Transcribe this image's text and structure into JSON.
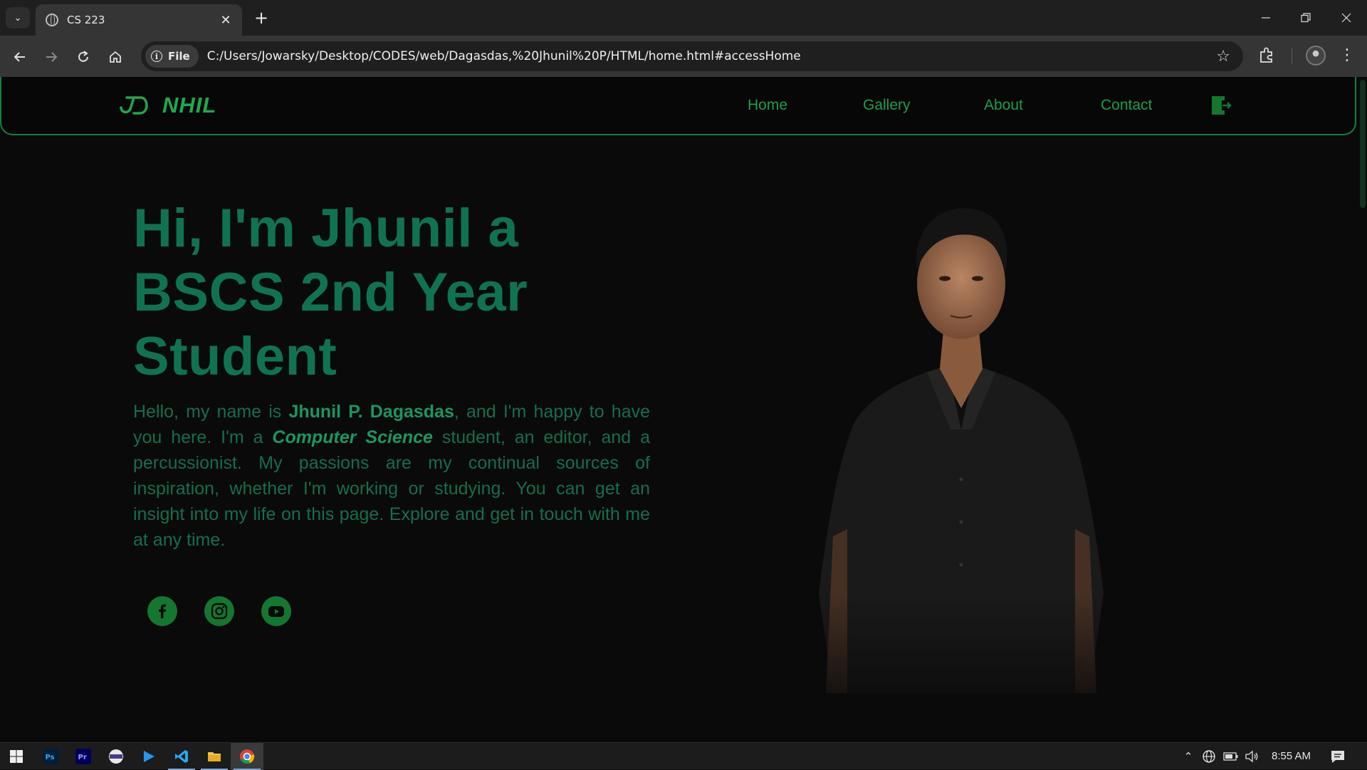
{
  "browser": {
    "tab_title": "CS 223",
    "new_tab": "+",
    "site_chip": "File",
    "url": "C:/Users/Jowarsky/Desktop/CODES/web/Dagasdas,%20Jhunil%20P/HTML/home.html#accessHome"
  },
  "site": {
    "logo_text": "NHIL",
    "nav": [
      "Home",
      "Gallery",
      "About",
      "Contact"
    ],
    "accent_color": "#1ea94c",
    "title_color": "#0f7352"
  },
  "hero": {
    "title_line1": "Hi, I'm Jhunil a",
    "title_line2": "BSCS 2nd Year",
    "title_line3": "Student",
    "para_1": "Hello, my name is ",
    "name": "Jhunil P. Dagasdas",
    "para_2": ", and I'm happy to have you here. I'm a ",
    "major": "Computer Science",
    "para_3": " student, an editor, and a percussionist. My passions are my continual sources of inspiration, whether I'm working or studying. You can get an insight into my life on this page. Explore and get in touch with me at any time.",
    "socials": [
      "facebook-icon",
      "instagram-icon",
      "youtube-icon"
    ]
  },
  "taskbar": {
    "apps": [
      "windows-start-icon",
      "photoshop-icon",
      "premiere-icon",
      "app-icon",
      "media-player-icon",
      "vscode-icon",
      "file-explorer-icon",
      "chrome-icon"
    ],
    "time": "8:55 AM"
  }
}
